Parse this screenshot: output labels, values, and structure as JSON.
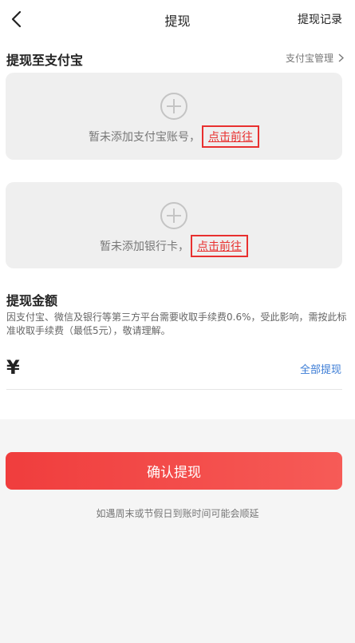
{
  "header": {
    "title": "提现",
    "right_link": "提现记录"
  },
  "alipay_section": {
    "title": "提现至支付宝",
    "manage_link": "支付宝管理"
  },
  "alipay_card": {
    "text": "暂未添加支付宝账号，",
    "link": "点击前往"
  },
  "bank_card": {
    "text": "暂未添加银行卡，",
    "link": "点击前往"
  },
  "amount_section": {
    "title": "提现金额",
    "notice": "因支付宝、微信及银行等第三方平台需要收取手续费0.6%，受此影响，需按此标准收取手续费（最低5元），敬请理解。",
    "currency": "¥",
    "withdraw_all": "全部提现"
  },
  "confirm_button": "确认提现",
  "footnote": "如遇周末或节假日到账时间可能会顺延",
  "colors": {
    "accent_red": "#e8302f",
    "link_blue": "#3a7bd5"
  }
}
